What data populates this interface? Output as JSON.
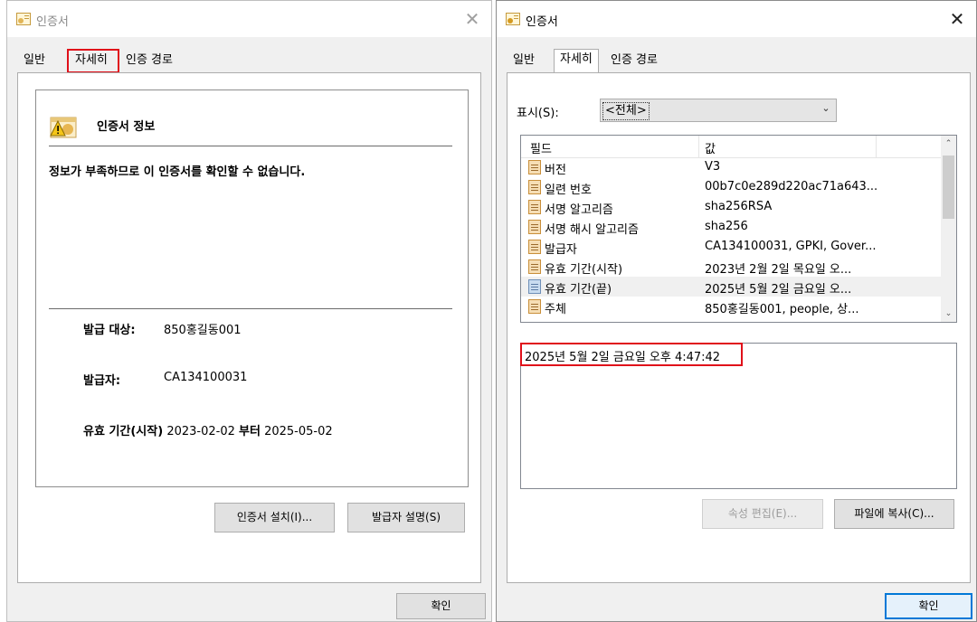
{
  "left_dialog": {
    "title": "인증서",
    "tabs": [
      "일반",
      "자세히",
      "인증 경로"
    ],
    "info_heading": "인증서 정보",
    "warning": "정보가 부족하므로 이 인증서를 확인할 수 없습니다.",
    "issued_to_label": "발급 대상:",
    "issued_to_value": "850홍길동001",
    "issued_by_label": "발급자:",
    "issued_by_value": "CA134100031",
    "validity_label": "유효 기간(시작)",
    "valid_from": "2023-02-02",
    "validity_to_label": "부터",
    "valid_to": "2025-05-02",
    "install_button": "인증서 설치(I)...",
    "issuer_statement_button": "발급자 설명(S)",
    "ok_button": "확인"
  },
  "right_dialog": {
    "title": "인증서",
    "tabs": [
      "일반",
      "자세히",
      "인증 경로"
    ],
    "show_label": "표시(S):",
    "show_value": "<전체>",
    "list_header_field": "필드",
    "list_header_value": "값",
    "rows": [
      {
        "field": "버전",
        "value": "V3"
      },
      {
        "field": "일련 번호",
        "value": "00b7c0e289d220ac71a643..."
      },
      {
        "field": "서명 알고리즘",
        "value": "sha256RSA"
      },
      {
        "field": "서명 해시 알고리즘",
        "value": "sha256"
      },
      {
        "field": "발급자",
        "value": "CA134100031, GPKI, Gover..."
      },
      {
        "field": "유효 기간(시작)",
        "value": "2023년 2월 2일 목요일 오..."
      },
      {
        "field": "유효 기간(끝)",
        "value": "2025년 5월 2일 금요일 오..."
      },
      {
        "field": "주체",
        "value": "850홍길동001, people, 상..."
      }
    ],
    "detail_text": "2025년 5월 2일 금요일 오후 4:47:42",
    "edit_properties_button": "속성 편집(E)...",
    "copy_to_file_button": "파일에 복사(C)...",
    "ok_button": "확인"
  },
  "colors": {
    "highlight": "#e0101a",
    "dialog_bg": "#f0f0f0",
    "default_button_border": "#0078d7"
  },
  "icons": {
    "title_icon": "certificate-icon",
    "info_icon": "certificate-warning-icon",
    "field_icon": "field-document-icon"
  }
}
